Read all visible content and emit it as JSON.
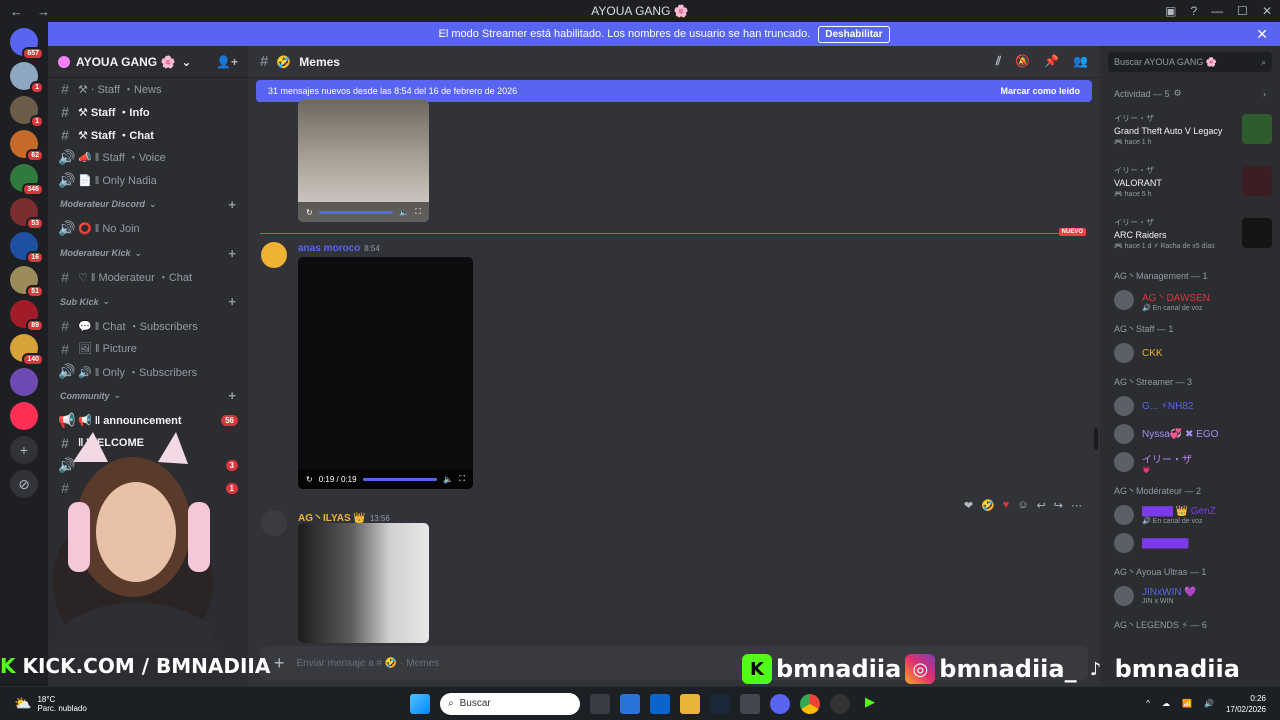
{
  "window": {
    "title": "AYOUA GANG 🌸",
    "nav_back": "←",
    "nav_fwd": "→"
  },
  "banner": {
    "text": "El modo Streamer está habilitado. Los nombres de usuario se han truncado.",
    "button": "Deshabilitar",
    "close": "✕"
  },
  "rail": {
    "servers": [
      {
        "badge": "657",
        "color": "#5865f2"
      },
      {
        "badge": "1",
        "color": "#8fa6c2"
      },
      {
        "badge": "1",
        "color": "#6b5c4a"
      },
      {
        "badge": "62",
        "color": "#c46a2a"
      },
      {
        "badge": "346",
        "color": "#2f7a3c"
      },
      {
        "badge": "53",
        "color": "#7a2e2e"
      },
      {
        "badge": "16",
        "color": "#1f4fa1"
      },
      {
        "badge": "51",
        "color": "#9b8a5a"
      },
      {
        "badge": "89",
        "color": "#a01c28"
      },
      {
        "badge": "140",
        "color": "#d8a23a"
      },
      {
        "badge": "",
        "color": "#6e4bb3"
      },
      {
        "badge": "",
        "color": "#ff2f55"
      }
    ],
    "add_server": "+",
    "discover": "⊘"
  },
  "guild": {
    "name": "AYOUA GANG 🌸",
    "chevron": "⌄",
    "add_member": "👤+"
  },
  "channels": [
    {
      "type": "cat-chan",
      "icon": "#",
      "label": "⚒ ‧ Staff ・News",
      "bold": false
    },
    {
      "type": "cat-chan",
      "icon": "#",
      "label": "⚒ Staff ・Info",
      "bold": true
    },
    {
      "type": "cat-chan",
      "icon": "#",
      "label": "⚒ Staff ・Chat",
      "bold": true
    },
    {
      "type": "voice",
      "icon": "🔊",
      "label": "📣 ‖ Staff ・Voice",
      "bold": false
    },
    {
      "type": "voice",
      "icon": "🔊",
      "label": "📄 ‖ Only Nadia",
      "bold": false
    }
  ],
  "categories": [
    {
      "label": "Moderateur Discord",
      "channels": [
        {
          "icon": "🔊",
          "label": "⭕ ‖ No Join"
        }
      ]
    },
    {
      "label": "Moderateur Kick",
      "channels": [
        {
          "icon": "#",
          "label": "♡ ‖ Moderateur ・Chat"
        }
      ]
    },
    {
      "label": "Sub Kick",
      "channels": [
        {
          "icon": "#",
          "label": "💬 ‖ Chat ・Subscribers"
        },
        {
          "icon": "#",
          "label": "🖼 ‖ Picture"
        },
        {
          "icon": "🔊",
          "label": "🔊 ‖ Only ・Subscribers"
        }
      ]
    },
    {
      "label": "Community",
      "channels": [
        {
          "icon": "📢",
          "label": "📢 ‖ announcement",
          "pill": "56",
          "bold": true
        },
        {
          "icon": "#",
          "label": "‖ WELCOME",
          "bold": true
        },
        {
          "icon": "🔊",
          "label": "",
          "pill": "3"
        },
        {
          "icon": "#",
          "label": "",
          "pill": "1"
        }
      ]
    }
  ],
  "chat": {
    "channel": "Memes",
    "channel_prefix": "#",
    "new_messages": "31 mensajes nuevos desde las 8:54 del 16 de febrero de 2026",
    "mark_read": "Marcar como leído",
    "new_label": "NUEVO",
    "messages": [
      {
        "author": "anas moroco",
        "time": "8:54",
        "video_time": "0:19 / 0:19",
        "author_color": "#5865f2"
      },
      {
        "author": "AG丶ILYAS 👑",
        "time": "13:56",
        "author_color": "#f0b232"
      }
    ],
    "composer_placeholder": "Enviar mensaje a # 🤣 · Memes",
    "composer_plus": "+"
  },
  "members": {
    "search_placeholder": "Buscar AYOUA GANG 🌸",
    "activity_header": "Actividad — 5",
    "activities": [
      {
        "who": "イリー・ザ",
        "game": "Grand Theft Auto V Legacy",
        "sub": "🎮 hace 1 h",
        "color": "#2f5c2f"
      },
      {
        "who": "イリー・ザ",
        "game": "VALORANT",
        "sub": "🎮 hace 5 h",
        "color": "#3a1e24"
      },
      {
        "who": "イリー・ザ",
        "game": "ARC Raiders",
        "sub": "🎮 hace 1 d  ⚡ Racha de x5 días",
        "color": "#151515"
      }
    ],
    "roles": [
      {
        "name": "AG丶Management — 1",
        "members": [
          {
            "name": "AG丶DAWSEN",
            "color": "#da373c",
            "sub": "🔊 En canal de voz"
          }
        ]
      },
      {
        "name": "AG丶Staff — 1",
        "members": [
          {
            "name": "CKK",
            "color": "#f0b232",
            "sub": ""
          }
        ]
      },
      {
        "name": "AG丶Streamer — 3",
        "members": [
          {
            "name": "G... ⚡NH82",
            "color": "#5865f2",
            "sub": ""
          },
          {
            "name": "Nyssa💞 ✖ EGO",
            "color": "#a78bfa",
            "sub": ""
          },
          {
            "name": "イリー・ザ",
            "color": "#c084fc",
            "sub": "💗"
          }
        ]
      },
      {
        "name": "AG丶Modérateur — 2",
        "members": [
          {
            "name": "▇▇▇▇ 👑 GenZ",
            "color": "#7c3aed",
            "sub": "🔊 En canal de voz"
          },
          {
            "name": "▇▇▇▇▇▇",
            "color": "#7c3aed",
            "sub": ""
          }
        ]
      },
      {
        "name": "AG丶Ayoua Ultras — 1",
        "members": [
          {
            "name": "JINxWIN 💜",
            "color": "#5865f2",
            "sub": "JIN x WIN"
          }
        ]
      },
      {
        "name": "AG丶LEGENDS ⚡ — 6",
        "members": []
      }
    ]
  },
  "overlay": {
    "kick_handle": "KICK.COM / BMNADIIA",
    "kick_logo": "K",
    "socials": [
      "bmnadiia",
      "bmnadiia_",
      "bmnadiia"
    ]
  },
  "taskbar": {
    "temp": "18°C",
    "weather": "Parc. nublado",
    "search": "Buscar",
    "time": "0:26",
    "date": "17/02/2026"
  }
}
